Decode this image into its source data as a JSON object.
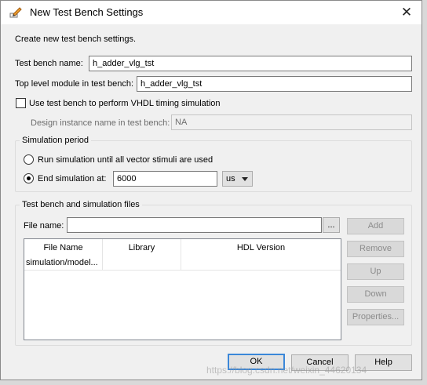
{
  "window": {
    "title": "New Test Bench Settings",
    "close_glyph": "✕"
  },
  "intro": "Create new test bench settings.",
  "test_bench_name": {
    "label": "Test bench name:",
    "value": "h_adder_vlg_tst"
  },
  "top_level_module": {
    "label": "Top level module in test bench:",
    "value": "h_adder_vlg_tst"
  },
  "vhdl_timing": {
    "label": "Use test bench to perform VHDL timing simulation",
    "checked": false
  },
  "design_instance": {
    "label": "Design instance name in test bench:",
    "value": "NA"
  },
  "simulation_period": {
    "title": "Simulation period",
    "run_until_label": "Run simulation until all vector stimuli are used",
    "end_at_label": "End simulation at:",
    "end_value": "6000",
    "unit": "us",
    "selected": "end_at"
  },
  "files_group": {
    "title": "Test bench and simulation files",
    "file_name_label": "File name:",
    "file_name_value": "",
    "browse_label": "...",
    "columns": [
      "File Name",
      "Library",
      "HDL Version"
    ],
    "rows": [
      [
        "simulation/model...",
        "",
        ""
      ]
    ],
    "buttons": {
      "add": "Add",
      "remove": "Remove",
      "up": "Up",
      "down": "Down",
      "properties": "Properties..."
    }
  },
  "footer": {
    "ok": "OK",
    "cancel": "Cancel",
    "help": "Help"
  },
  "watermark": "https://blog.csdn.net/weixin_44620134",
  "colors": {
    "default_button_border": "#3b87d9",
    "dialog_bg": "#f0f0f0"
  }
}
